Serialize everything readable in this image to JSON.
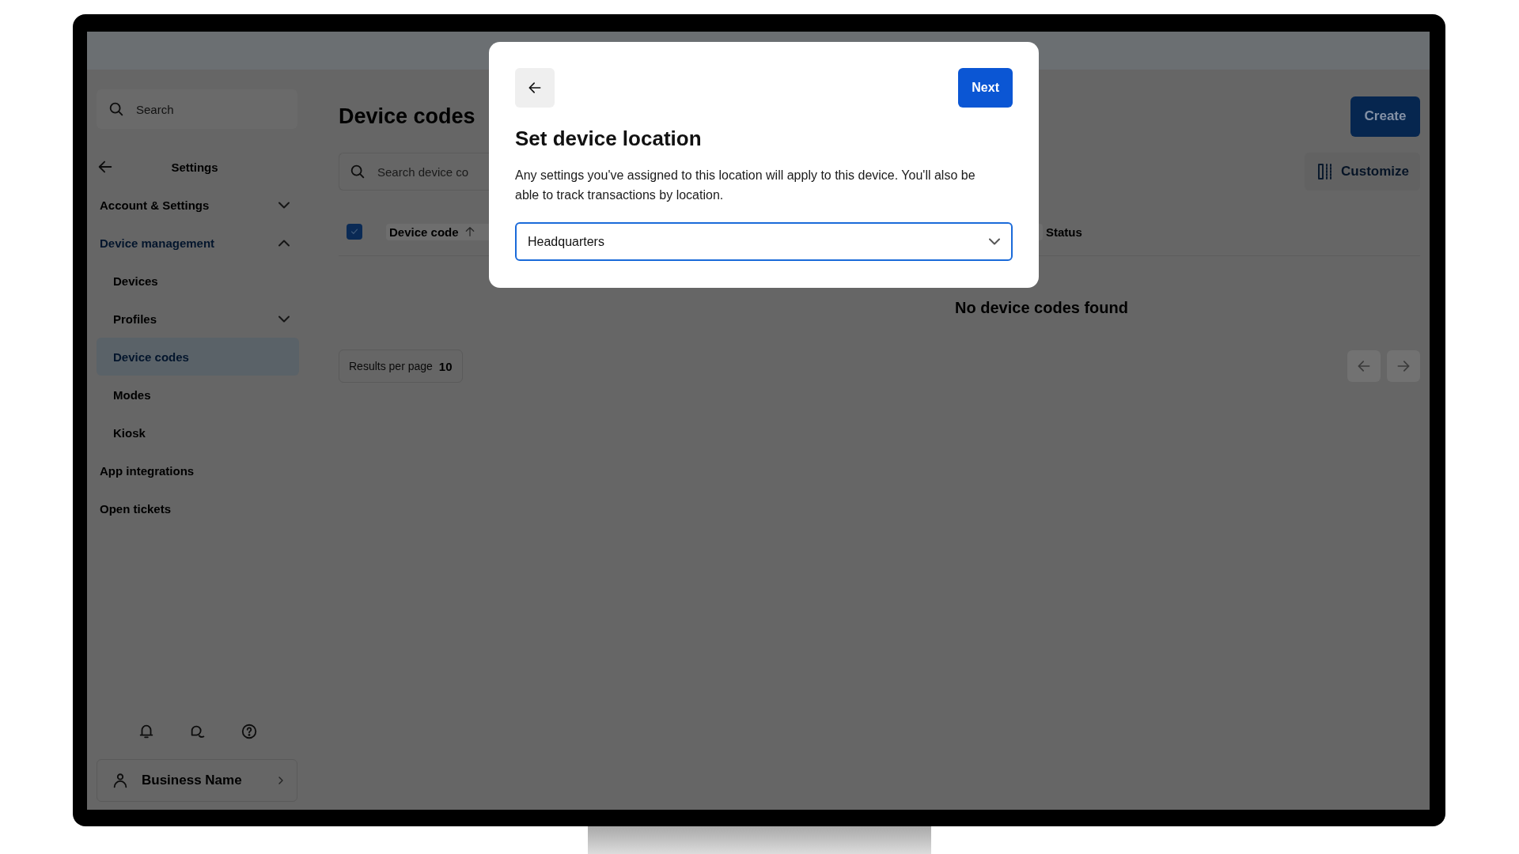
{
  "sidebar": {
    "search": {
      "placeholder": "Search"
    },
    "header": "Settings",
    "items": [
      {
        "label": "Account & Settings",
        "kind": "group",
        "expanded": false,
        "selected": false
      },
      {
        "label": "Device management",
        "kind": "group",
        "expanded": true,
        "selected": false,
        "children": [
          {
            "label": "Devices",
            "kind": "link",
            "selected": false
          },
          {
            "label": "Profiles",
            "kind": "group",
            "expanded": false,
            "selected": false
          },
          {
            "label": "Device codes",
            "kind": "link",
            "selected": true
          },
          {
            "label": "Modes",
            "kind": "link",
            "selected": false
          },
          {
            "label": "Kiosk",
            "kind": "link",
            "selected": false
          }
        ]
      },
      {
        "label": "App integrations",
        "kind": "link",
        "selected": false
      },
      {
        "label": "Open tickets",
        "kind": "link",
        "selected": false
      }
    ],
    "account": {
      "name": "Business Name"
    }
  },
  "page": {
    "title": "Device codes",
    "create_button": "Create",
    "search": {
      "placeholder": "Search device co"
    },
    "customize_button": "Customize",
    "table": {
      "select_all_checked": true,
      "columns": [
        {
          "label": "Device code",
          "sorted": true
        },
        {
          "label": "Status",
          "sorted": false
        }
      ],
      "empty_message": "No device codes found"
    },
    "pagination": {
      "label": "Results per page",
      "value": "10"
    }
  },
  "dialog": {
    "title": "Set device location",
    "description": "Any settings you've assigned to this location will apply to this device. You'll also be able to track transactions by location.",
    "next_button": "Next",
    "location_select": {
      "value": "Headquarters"
    }
  }
}
